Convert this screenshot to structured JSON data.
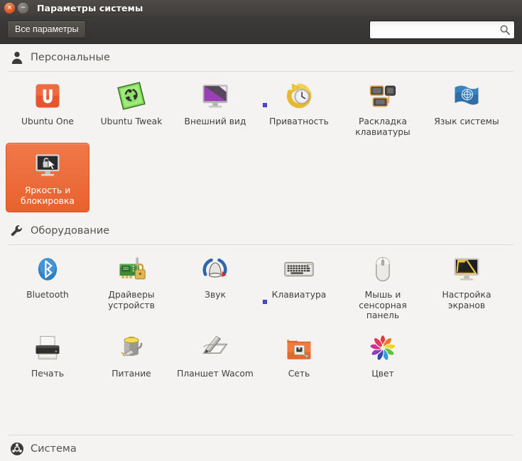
{
  "window": {
    "title": "Параметры системы",
    "buttons": [
      {
        "name": "close",
        "glyph": "×"
      },
      {
        "name": "minimize",
        "glyph": "−"
      }
    ]
  },
  "toolbar": {
    "all_settings_label": "Все параметры",
    "search": {
      "value": "",
      "placeholder": "",
      "icon": "search-icon"
    }
  },
  "sections": [
    {
      "id": "personal",
      "icon": "person-icon",
      "title": "Персональные",
      "items": [
        {
          "label": "Ubuntu One",
          "icon": "ubuntu-one-icon",
          "selected": false
        },
        {
          "label": "Ubuntu Tweak",
          "icon": "ubuntu-tweak-icon",
          "selected": false
        },
        {
          "label": "Внешний вид",
          "icon": "appearance-icon",
          "selected": false
        },
        {
          "label": "Приватность",
          "icon": "privacy-icon",
          "selected": false,
          "marker": true
        },
        {
          "label": "Раскладка клавиатуры",
          "icon": "keyboard-layout-icon",
          "selected": false
        },
        {
          "label": "Язык системы",
          "icon": "language-icon",
          "selected": false
        },
        {
          "label": "Яркость и блокировка",
          "icon": "brightness-lock-icon",
          "selected": true
        }
      ]
    },
    {
      "id": "hardware",
      "icon": "wrench-icon",
      "title": "Оборудование",
      "items": [
        {
          "label": "Bluetooth",
          "icon": "bluetooth-icon",
          "selected": false
        },
        {
          "label": "Драйверы устройств",
          "icon": "device-drivers-icon",
          "selected": false
        },
        {
          "label": "Звук",
          "icon": "sound-icon",
          "selected": false
        },
        {
          "label": "Клавиатура",
          "icon": "keyboard-icon",
          "selected": false,
          "marker": true
        },
        {
          "label": "Мышь и сенсорная панель",
          "icon": "mouse-touchpad-icon",
          "selected": false
        },
        {
          "label": "Настройка экранов",
          "icon": "displays-icon",
          "selected": false
        },
        {
          "label": "Печать",
          "icon": "printer-icon",
          "selected": false
        },
        {
          "label": "Питание",
          "icon": "power-icon",
          "selected": false
        },
        {
          "label": "Планшет Wacom",
          "icon": "wacom-tablet-icon",
          "selected": false
        },
        {
          "label": "Сеть",
          "icon": "network-icon",
          "selected": false
        },
        {
          "label": "Цвет",
          "icon": "color-icon",
          "selected": false
        }
      ]
    },
    {
      "id": "system",
      "icon": "ubuntu-logo-icon",
      "title": "Система",
      "items": []
    }
  ],
  "colors": {
    "accent": "#e9622e",
    "titlebar": "#413e3c",
    "toolbar": "#3a3836",
    "content_bg": "#f4f3f2",
    "marker": "#4b4ccb"
  }
}
